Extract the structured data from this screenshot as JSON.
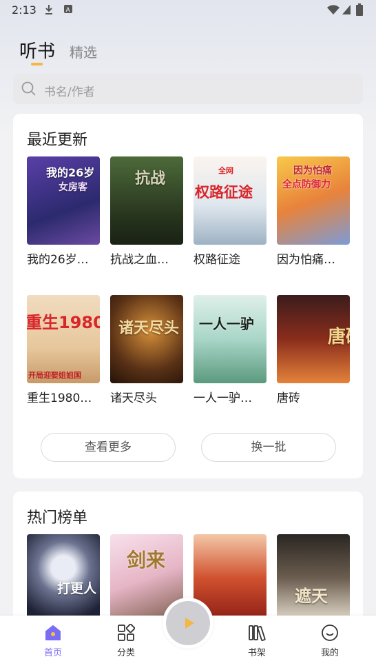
{
  "status": {
    "time": "2:13"
  },
  "tabs": {
    "active": "听书",
    "second": "精选"
  },
  "search": {
    "placeholder": "书名/作者"
  },
  "recent": {
    "title": "最近更新",
    "books": [
      {
        "title": "我的26岁…",
        "cover_text": "我的26岁",
        "cover_sub": "女房客"
      },
      {
        "title": "抗战之血…",
        "cover_text": "抗战",
        "cover_sub": ""
      },
      {
        "title": "权路征途",
        "cover_text": "权路征途",
        "cover_sub": "全网"
      },
      {
        "title": "因为怕痛…",
        "cover_text": "因为怕痛",
        "cover_sub": "全点防御力"
      },
      {
        "title": "重生1980…",
        "cover_text": "重生1980",
        "cover_sub": "开局迎娶姐姐国"
      },
      {
        "title": "诸天尽头",
        "cover_text": "诸天尽头",
        "cover_sub": ""
      },
      {
        "title": "一人一驴…",
        "cover_text": "一人一驴",
        "cover_sub": ""
      },
      {
        "title": "唐砖",
        "cover_text": "唐砖",
        "cover_sub": ""
      }
    ],
    "more_label": "查看更多",
    "refresh_label": "换一批"
  },
  "hot": {
    "title": "热门榜单",
    "books": [
      {
        "cover_text": "打更人"
      },
      {
        "cover_text": "剑来"
      },
      {
        "cover_text": ""
      },
      {
        "cover_text": "遮天"
      }
    ]
  },
  "nav": {
    "home": "首页",
    "category": "分类",
    "shelf": "书架",
    "mine": "我的"
  },
  "colors": {
    "accent": "#f3b744",
    "home_icon": "#7b6cf6"
  }
}
